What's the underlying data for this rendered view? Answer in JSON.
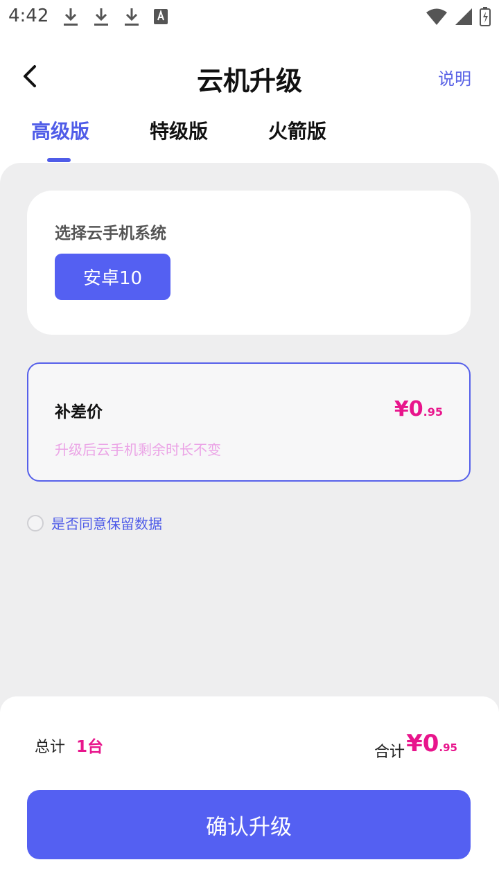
{
  "status_bar": {
    "time": "4:42",
    "left_icons": [
      "download-icon",
      "download-icon",
      "download-icon",
      "font-a-icon"
    ],
    "right_icons": [
      "wifi-icon",
      "signal-icon",
      "battery-icon"
    ]
  },
  "header": {
    "title": "云机升级",
    "back_icon": "chevron-left-icon",
    "help_label": "说明"
  },
  "tabs": [
    {
      "label": "高级版",
      "active": true
    },
    {
      "label": "特级版",
      "active": false
    },
    {
      "label": "火箭版",
      "active": false
    }
  ],
  "system_section": {
    "label": "选择云手机系统",
    "option": "安卓10"
  },
  "price_card": {
    "label": "补差价",
    "currency": "¥",
    "integer": "0",
    "decimal": ".95",
    "note": "升级后云手机剩余时长不变"
  },
  "agree": {
    "label": "是否同意保留数据",
    "checked": false
  },
  "footer": {
    "total_label": "总计",
    "total_count": "1台",
    "sum_label": "合计",
    "sum_currency": "¥",
    "sum_integer": "0",
    "sum_decimal": ".95",
    "confirm_label": "确认升级"
  },
  "colors": {
    "accent": "#5460F2",
    "price": "#E8158C",
    "note": "#EBA3E6",
    "background": "#EEEEEF"
  }
}
